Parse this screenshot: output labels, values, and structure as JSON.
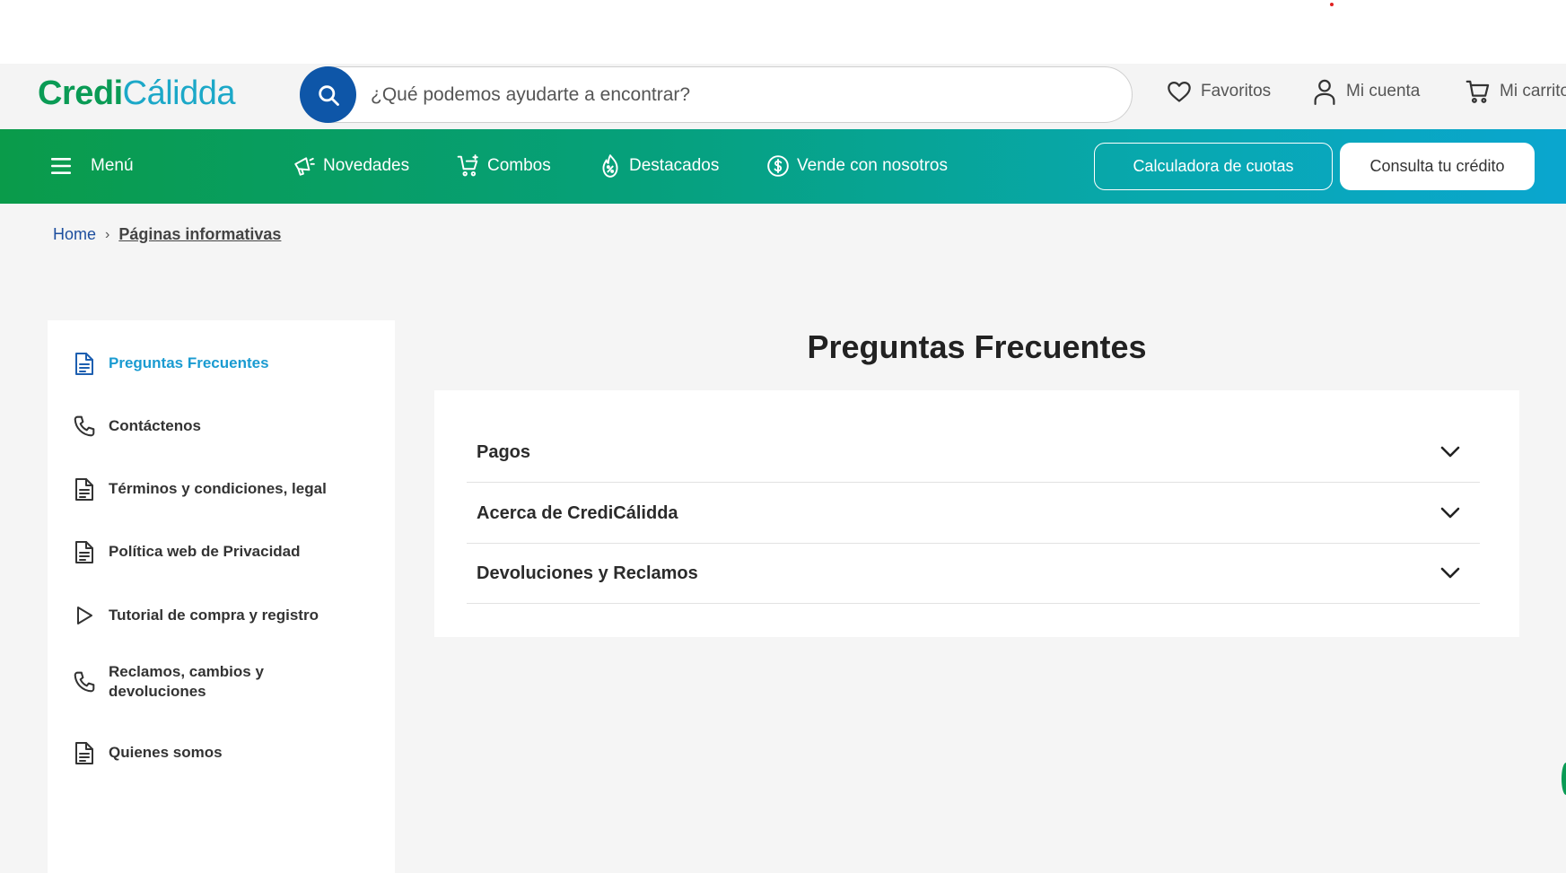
{
  "header": {
    "logo_part1": "Credi",
    "logo_part2": "Cálidda",
    "search_placeholder": "¿Qué podemos ayudarte a encontrar?",
    "favorites": "Favoritos",
    "account": "Mi cuenta",
    "cart": "Mi carrito"
  },
  "nav": {
    "menu": "Menú",
    "items": [
      "Novedades",
      "Combos",
      "Destacados",
      "Vende con nosotros"
    ],
    "calculator_button": "Calculadora de cuotas",
    "credit_button": "Consulta tu crédito"
  },
  "breadcrumb": {
    "home": "Home",
    "separator": "›",
    "current": "Páginas informativas"
  },
  "sidebar": {
    "items": [
      {
        "label": "Preguntas Frecuentes",
        "icon": "document-icon",
        "active": true
      },
      {
        "label": "Contáctenos",
        "icon": "phone-icon",
        "active": false
      },
      {
        "label": "Términos y condiciones, legal",
        "icon": "document-icon",
        "active": false
      },
      {
        "label": "Política web de Privacidad",
        "icon": "document-icon",
        "active": false
      },
      {
        "label": "Tutorial de compra y registro",
        "icon": "play-icon",
        "active": false
      },
      {
        "label": "Reclamos, cambios y devoluciones",
        "icon": "phone-icon",
        "active": false
      },
      {
        "label": "Quienes somos",
        "icon": "document-icon",
        "active": false
      }
    ]
  },
  "faq": {
    "title": "Preguntas Frecuentes",
    "sections": [
      "Pagos",
      "Acerca de CrediCálidda",
      "Devoluciones y Reclamos"
    ]
  },
  "colors": {
    "green": "#0a9b4a",
    "teal": "#0aa6cf",
    "navy": "#0e56a8",
    "active_link": "#1a9bd1"
  }
}
